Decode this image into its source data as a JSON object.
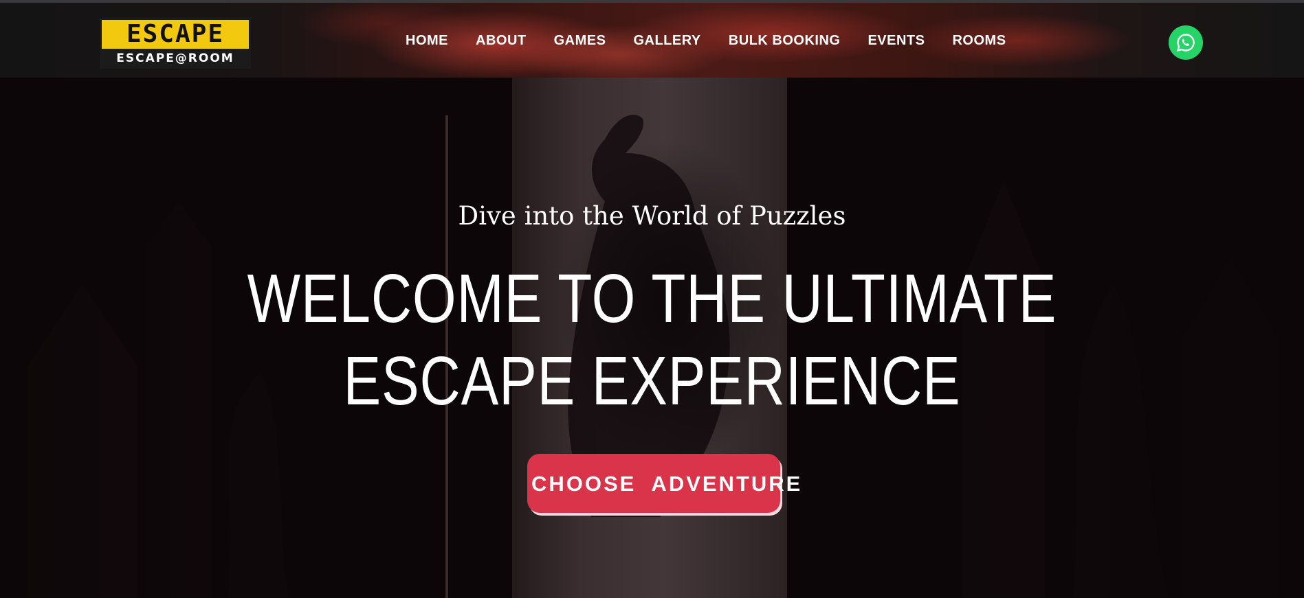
{
  "header": {
    "logo": {
      "main_text": "ESCAPE",
      "sub_text": "ESCAPE@ROOM",
      "colors": {
        "plate": "#f2c90f",
        "background": "#1b1b1b"
      }
    },
    "nav": [
      {
        "label": "HOME"
      },
      {
        "label": "ABOUT"
      },
      {
        "label": "GAMES"
      },
      {
        "label": "GALLERY"
      },
      {
        "label": "BULK BOOKING"
      },
      {
        "label": "EVENTS"
      },
      {
        "label": "ROOMS"
      }
    ],
    "whatsapp": {
      "icon": "whatsapp-icon",
      "color": "#25d366"
    }
  },
  "hero": {
    "subtitle": "Dive into the World of Puzzles",
    "title_line1": "WELCOME TO THE ULTIMATE",
    "title_line2": "ESCAPE EXPERIENCE",
    "cta_label": "CHOOSE  ADVENTURE",
    "cta_color": "#d9344a"
  }
}
